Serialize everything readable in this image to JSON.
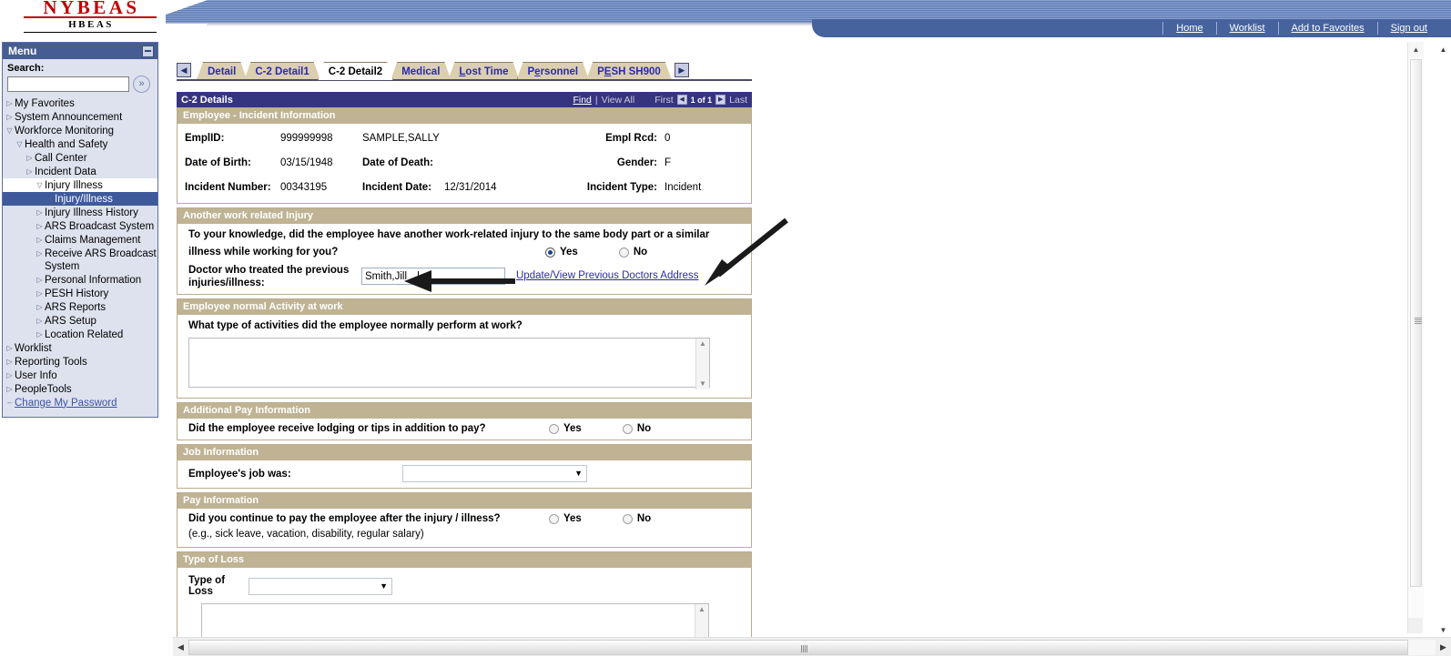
{
  "branding": {
    "logo_top": "NYBEAS",
    "logo_bottom": "HBEAS"
  },
  "topnav": [
    {
      "label": "Home"
    },
    {
      "label": "Worklist"
    },
    {
      "label": "Add to Favorites"
    },
    {
      "label": "Sign out"
    }
  ],
  "menu": {
    "title": "Menu",
    "minimize_icon": "minimize-icon",
    "search_label": "Search:",
    "search_value": "",
    "search_go_icon": "double-chevron-right-icon",
    "items": [
      {
        "label": "My Favorites",
        "indent": 0,
        "state": "collapsed"
      },
      {
        "label": "System Announcement",
        "indent": 0,
        "state": "collapsed"
      },
      {
        "label": "Workforce Monitoring",
        "indent": 0,
        "state": "expanded"
      },
      {
        "label": "Health and Safety",
        "indent": 1,
        "state": "expanded"
      },
      {
        "label": "Call Center",
        "indent": 2,
        "state": "collapsed"
      },
      {
        "label": "Incident Data",
        "indent": 2,
        "state": "collapsed"
      },
      {
        "label": "Injury Illness",
        "indent": 3,
        "state": "expanded"
      },
      {
        "label": "Injury/Illness",
        "indent": 4,
        "state": "leaf",
        "selected": true
      },
      {
        "label": "Injury Illness History",
        "indent": 3,
        "state": "collapsed"
      },
      {
        "label": "ARS Broadcast System",
        "indent": 3,
        "state": "collapsed"
      },
      {
        "label": "Claims Management",
        "indent": 3,
        "state": "collapsed"
      },
      {
        "label": "Receive ARS Broadcast System",
        "indent": 3,
        "state": "collapsed"
      },
      {
        "label": "Personal Information",
        "indent": 3,
        "state": "collapsed"
      },
      {
        "label": "PESH History",
        "indent": 3,
        "state": "collapsed"
      },
      {
        "label": "ARS Reports",
        "indent": 3,
        "state": "collapsed"
      },
      {
        "label": "ARS Setup",
        "indent": 3,
        "state": "collapsed"
      },
      {
        "label": "Location Related",
        "indent": 3,
        "state": "collapsed"
      },
      {
        "label": "Worklist",
        "indent": 0,
        "state": "collapsed"
      },
      {
        "label": "Reporting Tools",
        "indent": 0,
        "state": "collapsed"
      },
      {
        "label": "User Info",
        "indent": 0,
        "state": "collapsed"
      },
      {
        "label": "PeopleTools",
        "indent": 0,
        "state": "collapsed"
      },
      {
        "label": "Change My Password",
        "indent": 0,
        "state": "leaf",
        "link": true
      }
    ]
  },
  "tabs": {
    "prev_icon": "left-arrow-icon",
    "next_icon": "right-arrow-icon",
    "items": [
      {
        "label": "Detail",
        "active": false
      },
      {
        "label": "C-2 Detail1",
        "active": false
      },
      {
        "label": "C-2 Detail2",
        "active": true
      },
      {
        "label": "Medical",
        "active": false
      },
      {
        "label": "Lost Time",
        "active": false
      },
      {
        "label": "Personnel",
        "active": false
      },
      {
        "label": "PESH SH900",
        "active": false
      }
    ]
  },
  "grid": {
    "title": "C-2 Details",
    "find": "Find",
    "separator": "|",
    "view_all": "View All",
    "first": "First",
    "prev_icon": "left-arrow-icon",
    "counter": "1 of 1",
    "next_icon": "right-arrow-icon",
    "last": "Last"
  },
  "employee_section": {
    "header": "Employee - Incident Information",
    "rows": [
      {
        "label1": "EmplID:",
        "value1": "999999998",
        "label2": "SAMPLE,SALLY",
        "value2": "",
        "label3": "Empl Rcd:",
        "value3": "0"
      },
      {
        "label1": "Date of Birth:",
        "value1": "03/15/1948",
        "label2": "Date of Death:",
        "value2": "",
        "label3": "Gender:",
        "value3": "F"
      },
      {
        "label1": "Incident Number:",
        "value1": "00343195",
        "label2": "Incident Date:",
        "value2": "12/31/2014",
        "label3": "Incident Type:",
        "value3": "Incident"
      }
    ]
  },
  "another_injury": {
    "header": "Another work related Injury",
    "question_line1": "To your knowledge, did the employee have another work-related injury to the same body part or a similar",
    "question_line2": "illness while working for you?",
    "yes_label": "Yes",
    "no_label": "No",
    "selected": "Yes",
    "doctor_label_line1": "Doctor who treated the previous",
    "doctor_label_line2": "injuries/illness:",
    "doctor_value": "Smith,Jill",
    "doctor_link": "Update/View Previous Doctors Address"
  },
  "normal_activity": {
    "header": "Employee normal Activity at work",
    "question": "What type of activities did the employee normally perform at  work?",
    "value": "",
    "scroll_up_icon": "scroll-up-icon",
    "scroll_down_icon": "scroll-down-icon"
  },
  "additional_pay": {
    "header": "Additional Pay Information",
    "question": "Did the employee receive lodging or tips in addition to pay?",
    "yes_label": "Yes",
    "no_label": "No",
    "selected": ""
  },
  "job_information": {
    "header": "Job Information",
    "label": "Employee's job was:",
    "value": "",
    "dropdown_icon": "chevron-down-icon"
  },
  "pay_information": {
    "header": "Pay Information",
    "question": "Did you continue to pay the employee after the injury / illness?",
    "hint": "(e.g., sick leave, vacation, disability, regular salary)",
    "yes_label": "Yes",
    "no_label": "No",
    "selected": ""
  },
  "type_of_loss": {
    "header": "Type of Loss",
    "label": "Type of Loss",
    "value": "",
    "dropdown_icon": "chevron-down-icon",
    "notes_value": "",
    "scroll_up_icon": "scroll-up-icon"
  },
  "scrollbars": {
    "inner_up_icon": "scroll-up-icon",
    "outer_up_icon": "scroll-up-icon",
    "outer_down_icon": "scroll-down-icon",
    "outer_left_icon": "scroll-left-icon",
    "outer_right_icon": "scroll-right-icon"
  },
  "annotations": [
    {
      "name": "arrow-to-doctor-field",
      "kind": "left-arrow-annotation"
    },
    {
      "name": "arrow-to-doctors-address-link",
      "kind": "diagonal-arrow-annotation"
    }
  ]
}
